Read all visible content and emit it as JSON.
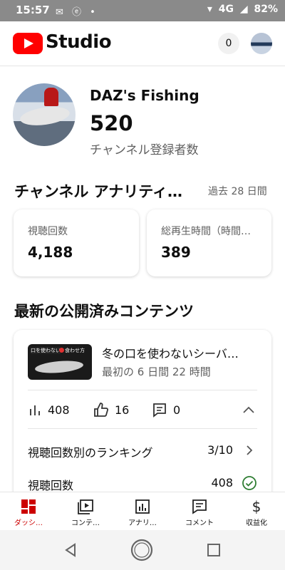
{
  "status_bar": {
    "time": "15:57",
    "network": "4G",
    "battery": "82%"
  },
  "app": {
    "title": "Studio",
    "notification_count": "0"
  },
  "channel": {
    "name": "DAZ's Fishing",
    "subscribers": "520",
    "subscribers_label": "チャンネル登録者数"
  },
  "analytics": {
    "title": "チャンネル アナリティ…",
    "period": "過去 28 日間",
    "metrics": [
      {
        "label": "視聴回数",
        "value": "4,188"
      },
      {
        "label": "総再生時間（時間…",
        "value": "389"
      }
    ]
  },
  "latest": {
    "section_title": "最新の公開済みコンテンツ",
    "video": {
      "thumbnail_text_left": "口を使わない",
      "thumbnail_text_right": "食わせ方",
      "title": "冬の口を使わないシーバ…",
      "period": "最初の 6 日間 22 時間",
      "views": "408",
      "likes": "16",
      "comments": "0"
    },
    "rows": [
      {
        "label": "視聴回数別のランキング",
        "value": "3/10",
        "icon": "chevron-right-icon"
      },
      {
        "label": "視聴回数",
        "value": "408",
        "icon": "check-circle-icon"
      }
    ]
  },
  "bottom_nav": [
    {
      "label": "ダッシ…",
      "icon": "dashboard-icon",
      "active": true
    },
    {
      "label": "コンテ…",
      "icon": "content-icon",
      "active": false
    },
    {
      "label": "アナリ…",
      "icon": "analytics-icon",
      "active": false
    },
    {
      "label": "コメント",
      "icon": "comment-icon",
      "active": false
    },
    {
      "label": "収益化",
      "icon": "dollar-icon",
      "active": false
    }
  ],
  "colors": {
    "brand_red": "#ff0000",
    "active_red": "#cc0000",
    "check_green": "#2e7d32",
    "secondary_text": "#606060"
  }
}
